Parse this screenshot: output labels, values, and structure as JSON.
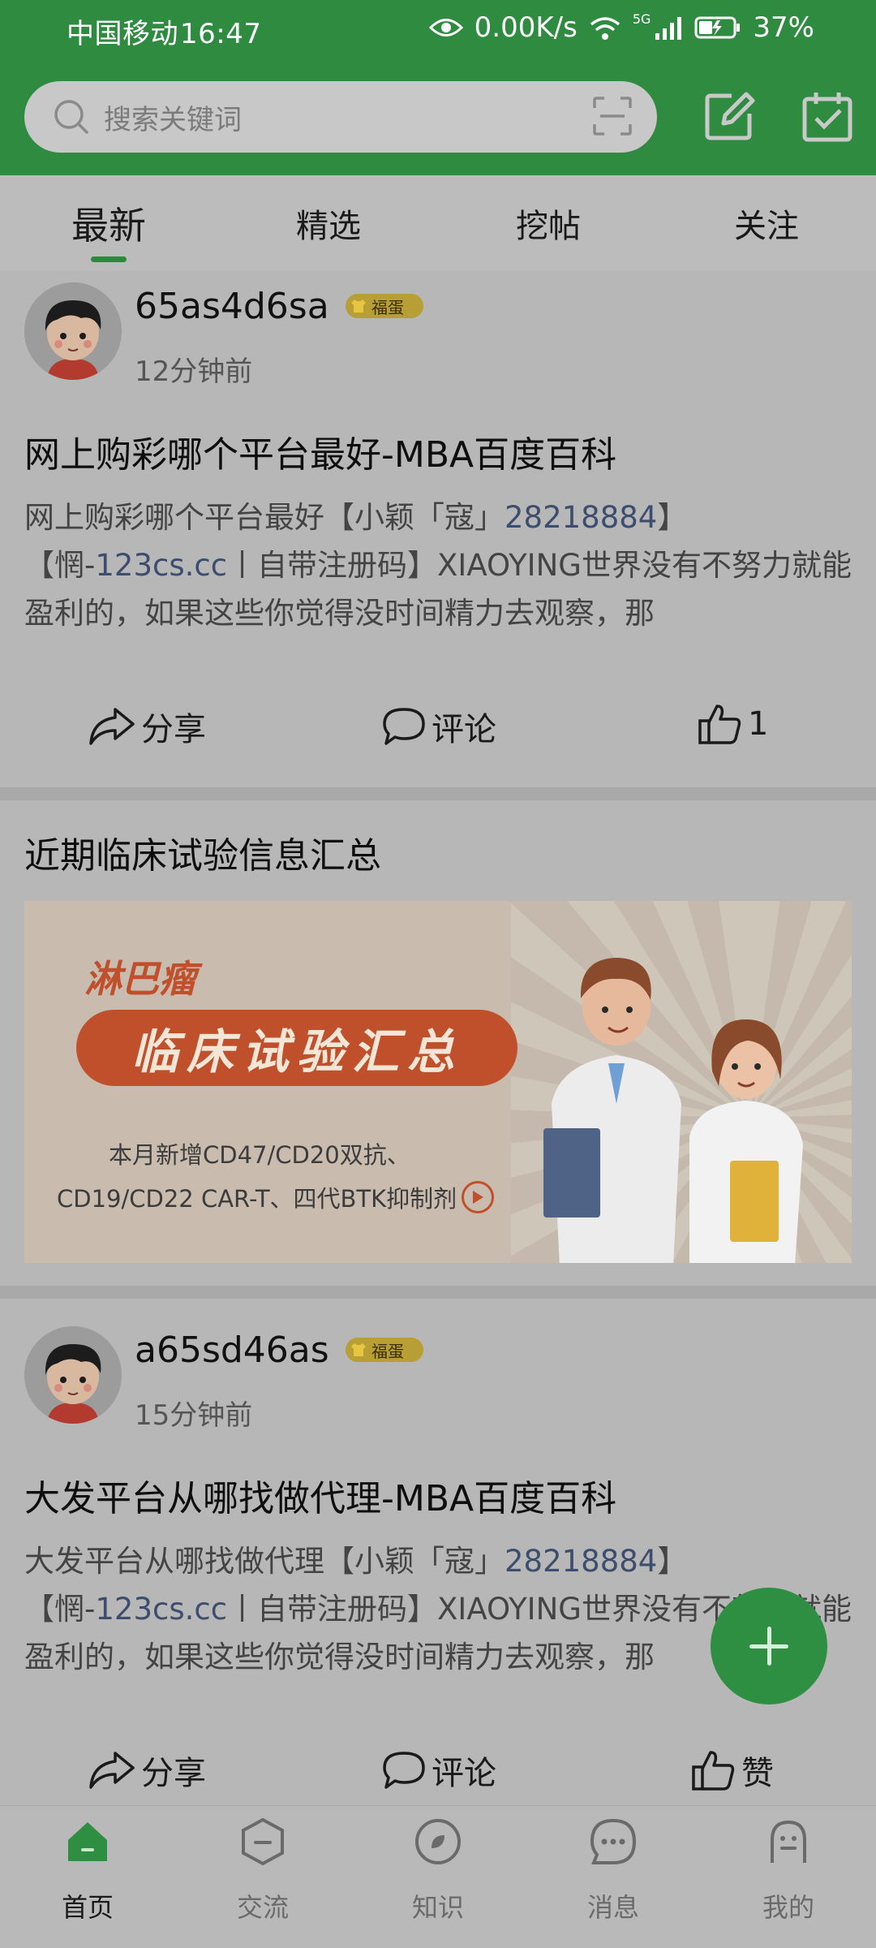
{
  "status_bar": {
    "carrier": "中国移动",
    "time": "16:47",
    "speed": "0.00K/s",
    "network": "5G",
    "battery": "37%"
  },
  "search": {
    "placeholder": "搜索关键词",
    "icon": "search-icon",
    "scan_icon": "scan-icon",
    "edit_icon": "edit-icon",
    "checkin_icon": "calendar-check-icon"
  },
  "tabs": [
    {
      "label": "最新",
      "active": true
    },
    {
      "label": "精选",
      "active": false
    },
    {
      "label": "挖帖",
      "active": false
    },
    {
      "label": "关注",
      "active": false
    }
  ],
  "posts": [
    {
      "username": "65as4d6sa",
      "badge": "福蛋",
      "time": "12分钟前",
      "title": "网上购彩哪个平台最好-MBA百度百科",
      "body": {
        "p1": "网上购彩哪个平台最好【小颖「寇」",
        "link1": "28218884",
        "p2": "】【惘-",
        "link2": "123cs.cc",
        "p3": "丨自带注册码】XIAOYING世界没有不努力就能盈利的，如果这些你觉得没时间精力去观察，那"
      },
      "actions": {
        "share": "分享",
        "comment": "评论",
        "like": "1"
      }
    },
    {
      "username": "a65sd46as",
      "badge": "福蛋",
      "time": "15分钟前",
      "title": "大发平台从哪找做代理-MBA百度百科",
      "body": {
        "p1": "大发平台从哪找做代理【小颖「寇」",
        "link1": "28218884",
        "p2": "】【惘-",
        "link2": "123cs.cc",
        "p3": "丨自带注册码】XIAOYING世界没有不努力就能盈利的，如果这些你觉得没时间精力去观察，那"
      },
      "actions": {
        "share": "分享",
        "comment": "评论",
        "like": "赞"
      }
    }
  ],
  "banner": {
    "title": "近期临床试验信息汇总",
    "small": "淋巴瘤",
    "pill": "临床试验汇总",
    "line1": "本月新增CD47/CD20双抗、",
    "line2": "CD19/CD22 CAR-T、四代BTK抑制剂"
  },
  "bottom_nav": [
    {
      "label": "首页",
      "icon": "home-icon",
      "active": true
    },
    {
      "label": "交流",
      "icon": "chat-hexagon-icon",
      "active": false
    },
    {
      "label": "知识",
      "icon": "knowledge-icon",
      "active": false
    },
    {
      "label": "消息",
      "icon": "message-icon",
      "active": false
    },
    {
      "label": "我的",
      "icon": "profile-icon",
      "active": false
    }
  ],
  "colors": {
    "brand_green": "#2e8b3f",
    "link": "#3c4d6e",
    "banner_orange": "#c0502c"
  }
}
